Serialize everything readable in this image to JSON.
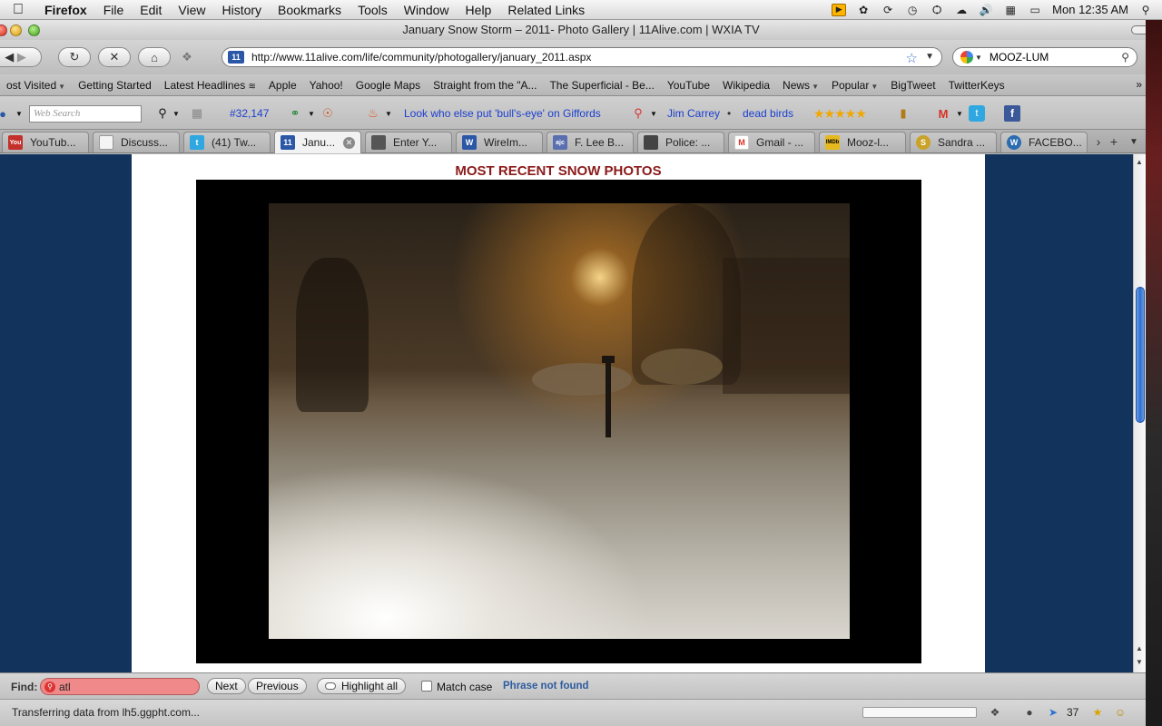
{
  "menubar": {
    "apple_icon": "apple-logo-icon",
    "app_name": "Firefox",
    "items": [
      "File",
      "Edit",
      "View",
      "History",
      "Bookmarks",
      "Tools",
      "Window",
      "Help",
      "Related Links"
    ],
    "clock": "Mon 12:35 AM"
  },
  "window": {
    "title": "January Snow Storm – 2011- Photo Gallery | 11Alive.com | WXIA TV"
  },
  "navbar": {
    "url": "http://www.11alive.com/life/community/photogallery/january_2011.aspx",
    "search_value": "MOOZ-LUM",
    "site_favicon": "11"
  },
  "bookmarks": {
    "items": [
      {
        "label": "ost Visited",
        "dropdown": true
      },
      {
        "label": "Getting Started"
      },
      {
        "label": "Latest Headlines",
        "rss": true
      },
      {
        "label": "Apple"
      },
      {
        "label": "Yahoo!"
      },
      {
        "label": "Google Maps"
      },
      {
        "label": "Straight from the \"A..."
      },
      {
        "label": "The Superficial - Be..."
      },
      {
        "label": "YouTube"
      },
      {
        "label": "Wikipedia"
      },
      {
        "label": "News",
        "dropdown": true
      },
      {
        "label": "Popular",
        "dropdown": true
      },
      {
        "label": "BigTweet"
      },
      {
        "label": "TwitterKeys"
      }
    ],
    "overflow": "»"
  },
  "addonbar": {
    "web_search_placeholder": "Web Search",
    "count": "#32,147",
    "headline_link": "Look who else put 'bull's-eye' on Giffords",
    "link_jim": "Jim Carrey",
    "separator": "•",
    "link_birds": "dead birds",
    "rating": "★★★★★",
    "facebook_glyph": "f",
    "twitter_glyph": "t"
  },
  "tabs": [
    {
      "label": "YouTub...",
      "favicon": "You",
      "color": "#c4302b"
    },
    {
      "label": "Discuss...",
      "favicon": "",
      "color": "#e8e8e8"
    },
    {
      "label": "(41) Tw...",
      "favicon": "t",
      "color": "#2fa7e0"
    },
    {
      "label": "Janu...",
      "favicon": "11",
      "color": "#2b57a6",
      "active": true
    },
    {
      "label": "Enter Y...",
      "favicon": "",
      "color": "#555555"
    },
    {
      "label": "WireIm...",
      "favicon": "W",
      "color": "#2b57a6"
    },
    {
      "label": "F. Lee B...",
      "favicon": "ajc",
      "color": "#5a6fb0"
    },
    {
      "label": "Police: ...",
      "favicon": "",
      "color": "#444444"
    },
    {
      "label": "Gmail - ...",
      "favicon": "M",
      "color": "#d93025"
    },
    {
      "label": "Mooz-l...",
      "favicon": "IMDb",
      "color": "#e6b91e"
    },
    {
      "label": "Sandra ...",
      "favicon": "S",
      "color": "#c9a227"
    },
    {
      "label": "FACEBO...",
      "favicon": "W",
      "color": "#2b6cb0"
    }
  ],
  "content": {
    "heading": "MOST RECENT SNOW PHOTOS",
    "heading_color": "#8b1a1a",
    "page_background": "#12345c"
  },
  "findbar": {
    "label": "Find:",
    "query": "atl",
    "next": "Next",
    "previous": "Previous",
    "highlight": "Highlight all",
    "match_case": "Match case",
    "match_case_checked": false,
    "status": "Phrase not found"
  },
  "statusbar": {
    "text": "Transferring data from lh5.ggpht.com...",
    "progress": 0.0,
    "count": "37"
  }
}
